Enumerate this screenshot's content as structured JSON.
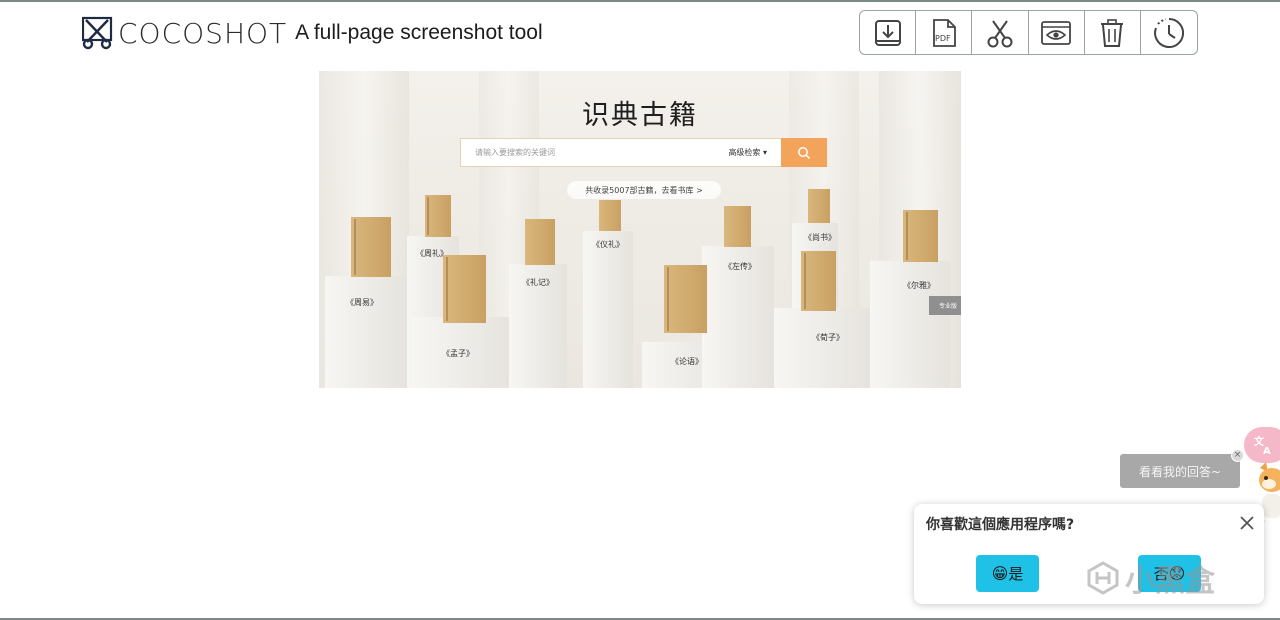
{
  "header": {
    "brand_name": "COCOSHOT",
    "tagline": "A full-page screenshot tool",
    "toolbar": [
      {
        "name": "download",
        "icon": "download-icon"
      },
      {
        "name": "pdf",
        "icon": "pdf-icon",
        "label": "PDF"
      },
      {
        "name": "crop",
        "icon": "scissors-icon"
      },
      {
        "name": "preview",
        "icon": "eye-icon"
      },
      {
        "name": "delete",
        "icon": "trash-icon"
      },
      {
        "name": "history",
        "icon": "clock-icon"
      }
    ]
  },
  "preview": {
    "title": "识典古籍",
    "search_placeholder": "请输入要搜索的关键词",
    "advanced_search": "高级检索",
    "collection_note": "共收录5007部古籍，去看书库 >",
    "side_tab": "专业版",
    "books": [
      {
        "label": "《周易》"
      },
      {
        "label": "《周礼》"
      },
      {
        "label": "《孟子》"
      },
      {
        "label": "《礼记》"
      },
      {
        "label": "《仪礼》"
      },
      {
        "label": "《论语》"
      },
      {
        "label": "《左传》"
      },
      {
        "label": "《尚书》"
      },
      {
        "label": "《荀子》"
      },
      {
        "label": "《尔雅》"
      }
    ]
  },
  "widget": {
    "tip": "看看我的回答~",
    "tip_close": "×",
    "translate_icon": "translate-icon"
  },
  "rating": {
    "question": "你喜歡這個應用程序嗎?",
    "yes_label": "是",
    "yes_emoji": "😁",
    "no_label": "否",
    "no_emoji": "😟"
  },
  "watermark": {
    "text": "小黑盒"
  },
  "colors": {
    "accent_orange": "#f4a45a",
    "rating_button": "#1fc2e6",
    "tip_bubble": "#a8a8a8",
    "translate_fab": "#f4b8c9"
  }
}
